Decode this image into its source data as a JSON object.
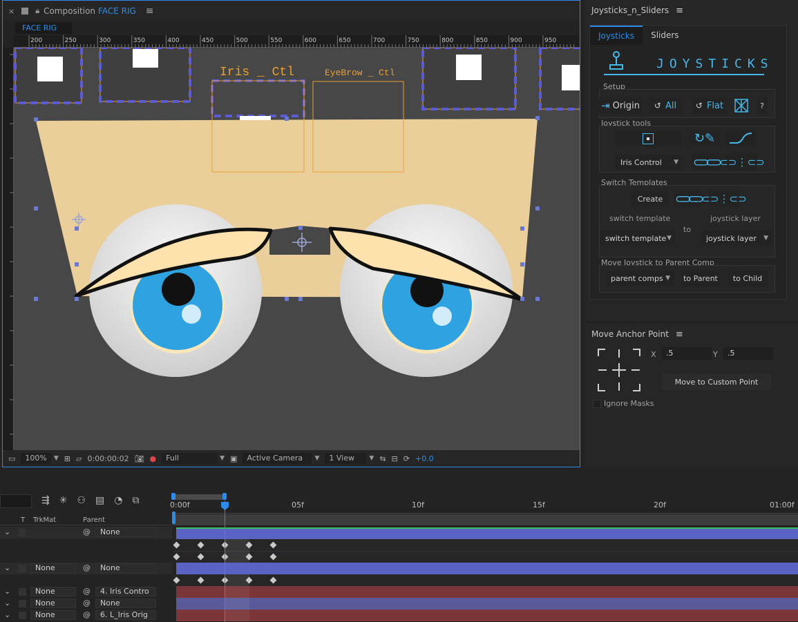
{
  "composition": {
    "tab_label": "Composition",
    "comp_name": "FACE RIG",
    "subtab": "FACE RIG",
    "ruler_labels": [
      "200",
      "250",
      "300",
      "350",
      "400",
      "450",
      "500",
      "550",
      "600",
      "650",
      "700",
      "750",
      "800",
      "850",
      "900",
      "950"
    ],
    "ctl_labels": {
      "iris": "Iris _ Ctl",
      "eyebrow": "EyeBrow _ Ctl"
    },
    "footer": {
      "zoom": "100%",
      "timecode": "0:00:00:02",
      "resolution": "Full",
      "camera": "Active Camera",
      "views": "1 View",
      "exposure": "+0.0"
    }
  },
  "joysticks_panel": {
    "title": "Joysticks_n_Sliders",
    "tabs": [
      "Joysticks",
      "Sliders"
    ],
    "banner": "JOYSTICKS",
    "setup_label": "Setup",
    "setup_buttons": {
      "origin": "Origin",
      "all": "All",
      "flat": "Flat",
      "help": "?"
    },
    "joystick_tools_label": "Joystick tools",
    "iris_control": "Iris Control",
    "switch_templates_label": "Switch Templates",
    "create": "Create",
    "switch_template_label": "switch template",
    "joystick_layer_label": "joystick layer",
    "to": "to",
    "switch_template_dd": "switch template",
    "joystick_layer_dd": "joystick layer",
    "move_parent_label": "Move Joystick to Parent Comp",
    "parent_comps_dd": "parent comps",
    "to_parent": "to Parent",
    "to_child": "to Child"
  },
  "anchor_panel": {
    "title": "Move Anchor Point",
    "x_label": "X",
    "x_value": ".5",
    "y_label": "Y",
    "y_value": ".5",
    "move_button": "Move to Custom Point",
    "ignore_masks": "Ignore Masks"
  },
  "timeline": {
    "columns": {
      "t": "T",
      "trkmat": "TrkMat",
      "parent": "Parent"
    },
    "time_labels": [
      "0:00f",
      "05f",
      "10f",
      "15f",
      "20f",
      "01:00f"
    ],
    "layers": [
      {
        "trkmat": "",
        "parent": "None"
      },
      {
        "trkmat": "None",
        "parent": "None"
      },
      {
        "trkmat": "None",
        "parent": "4. Iris Contro"
      },
      {
        "trkmat": "None",
        "parent": "None"
      },
      {
        "trkmat": "None",
        "parent": "6. L_Iris Orig"
      }
    ]
  },
  "colors": {
    "accent": "#2d8ceb",
    "joystick_blue": "#46b8ea",
    "handle": "#6b78d6",
    "ctl_orange": "#e8a032",
    "skin": "#ebcf9b",
    "iris": "#2fa3e2",
    "layer_blue": "#5964c2",
    "layer_red": "#7c3538"
  }
}
